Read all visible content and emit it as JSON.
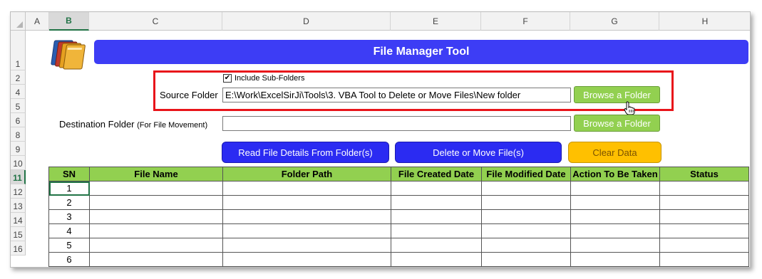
{
  "columns": [
    "A",
    "B",
    "C",
    "D",
    "E",
    "F",
    "G",
    "H"
  ],
  "selected_column": "B",
  "rows": [
    "1",
    "2",
    "4",
    "5",
    "6",
    "8",
    "9",
    "10",
    "11",
    "12",
    "13",
    "14",
    "15",
    "16"
  ],
  "selected_row": "11",
  "title": "File Manager Tool",
  "include_subfolders": {
    "label": "Include Sub-Folders",
    "checked": "✔"
  },
  "source_folder": {
    "label": "Source Folder",
    "value": "E:\\Work\\ExcelSirJi\\Tools\\3. VBA Tool to Delete or Move Files\\New folder",
    "browse_label": "Browse a Folder"
  },
  "destination_folder": {
    "label": "Destination Folder",
    "note": "(For File Movement)",
    "value": "",
    "browse_label": "Browse a Folder"
  },
  "actions": {
    "read_label": "Read File Details From Folder(s)",
    "delete_move_label": "Delete or Move File(s)",
    "clear_label": "Clear Data"
  },
  "table": {
    "headers": [
      "SN",
      "File Name",
      "Folder Path",
      "File Created Date",
      "File Modified Date",
      "Action To Be Taken",
      "Status"
    ],
    "sn": [
      "1",
      "2",
      "3",
      "4",
      "5",
      "6"
    ]
  },
  "colors": {
    "title_bg": "#3d3df5",
    "header_green": "#92d050",
    "highlight_red": "#e8141a",
    "clear_orange": "#ffc000"
  }
}
